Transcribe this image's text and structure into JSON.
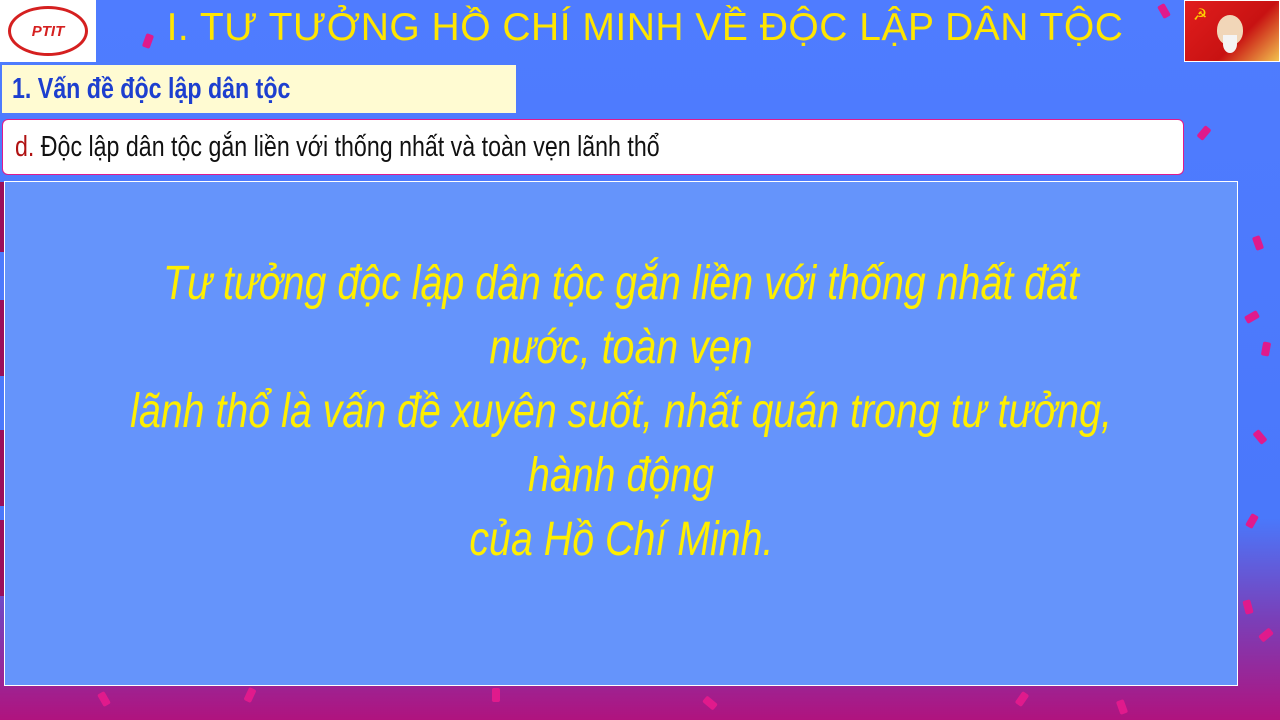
{
  "header": {
    "title": "I. TƯ TƯỞNG HỒ CHÍ MINH VỀ ĐỘC LẬP DÂN TỘC",
    "logo_text": "PTIT"
  },
  "section": {
    "heading": "1. Vấn đề độc lập dân tộc",
    "item_prefix": "d.",
    "item_text": "Độc lập dân tộc gắn liền với thống nhất và toàn vẹn lãnh thổ"
  },
  "quote": {
    "line1": "Tư tưởng độc lập dân tộc gắn liền với thống nhất đất nước, toàn vẹn",
    "line2": "lãnh thổ là vấn đề xuyên suốt, nhất quán trong tư tưởng, hành động",
    "line3": "của Hồ Chí Minh."
  },
  "colors": {
    "background": "#4f7cff",
    "title": "#ffe600",
    "heading": "#1d3fcf",
    "quote_text": "#ffef00",
    "quote_box": "#6594fb",
    "confetti": "#e01a8c"
  },
  "icons": [
    "ptit-logo-icon",
    "ho-chi-minh-portrait-icon",
    "confetti-decoration"
  ]
}
